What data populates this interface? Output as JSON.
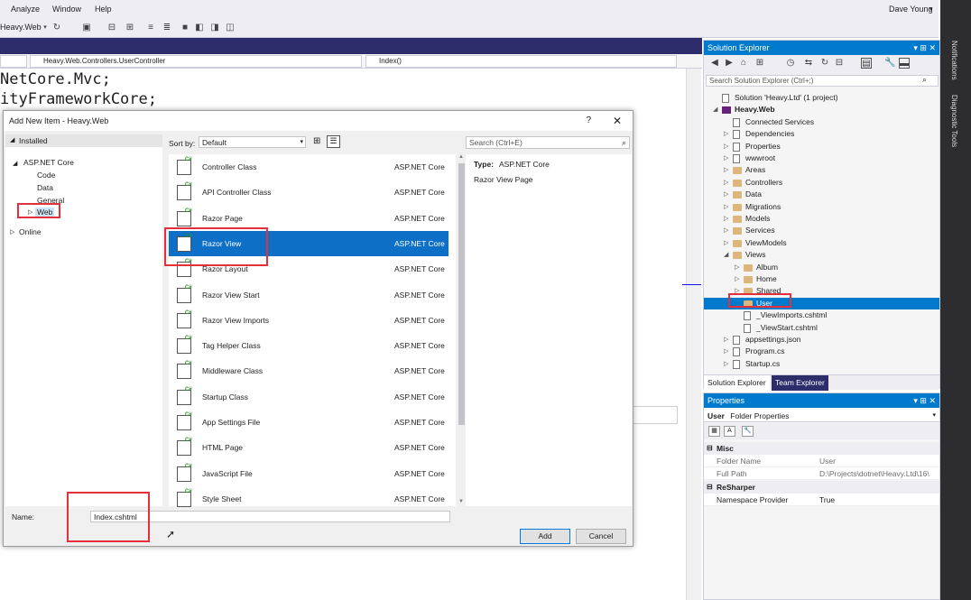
{
  "menu": {
    "items": [
      "Analyze",
      "Window",
      "Help"
    ]
  },
  "account": {
    "user_name": "Dave Young"
  },
  "toolbar": {
    "project_name": "Heavy.Web"
  },
  "editor": {
    "class_dropdown": "Heavy.Web.Controllers.UserController",
    "member_dropdown": "Index()",
    "code_lines": [
      "NetCore.Mvc;",
      "ityFrameworkCore;"
    ]
  },
  "dialog": {
    "title": "Add New Item - Heavy.Web",
    "help": "?",
    "close": "✕",
    "sort_label": "Sort by:",
    "sort_value": "Default",
    "search_placeholder": "Search (Ctrl+E)",
    "tree": {
      "installed": "Installed",
      "aspnet_core": "ASP.NET Core",
      "code": "Code",
      "data": "Data",
      "general": "General",
      "web": "Web",
      "online": "Online"
    },
    "items": [
      {
        "name": "Controller Class",
        "category": "ASP.NET Core"
      },
      {
        "name": "API Controller Class",
        "category": "ASP.NET Core"
      },
      {
        "name": "Razor Page",
        "category": "ASP.NET Core"
      },
      {
        "name": "Razor View",
        "category": "ASP.NET Core"
      },
      {
        "name": "Razor Layout",
        "category": "ASP.NET Core"
      },
      {
        "name": "Razor View Start",
        "category": "ASP.NET Core"
      },
      {
        "name": "Razor View Imports",
        "category": "ASP.NET Core"
      },
      {
        "name": "Tag Helper Class",
        "category": "ASP.NET Core"
      },
      {
        "name": "Middleware Class",
        "category": "ASP.NET Core"
      },
      {
        "name": "Startup Class",
        "category": "ASP.NET Core"
      },
      {
        "name": "App Settings File",
        "category": "ASP.NET Core"
      },
      {
        "name": "HTML Page",
        "category": "ASP.NET Core"
      },
      {
        "name": "JavaScript File",
        "category": "ASP.NET Core"
      },
      {
        "name": "Style Sheet",
        "category": "ASP.NET Core"
      }
    ],
    "details": {
      "type_label": "Type:",
      "type_value": "ASP.NET Core",
      "description": "Razor View Page"
    },
    "name_label": "Name:",
    "name_value": "Index.cshtml",
    "add_button": "Add",
    "cancel_button": "Cancel"
  },
  "solution_explorer": {
    "title": "Solution Explorer",
    "title_tools": "▾ ⊞ ✕",
    "search_placeholder": "Search Solution Explorer (Ctrl+;)",
    "tree": [
      {
        "label": "Solution 'Heavy.Ltd' (1 project)",
        "icon": "solution-icon"
      },
      {
        "label": "Heavy.Web",
        "icon": "project-icon"
      },
      {
        "label": "Connected Services",
        "icon": "connected-services-icon"
      },
      {
        "label": "Dependencies",
        "icon": "dependencies-icon"
      },
      {
        "label": "Properties",
        "icon": "wrench-icon"
      },
      {
        "label": "wwwroot",
        "icon": "globe-icon"
      },
      {
        "label": "Areas",
        "icon": "folder-icon"
      },
      {
        "label": "Controllers",
        "icon": "folder-icon"
      },
      {
        "label": "Data",
        "icon": "folder-icon"
      },
      {
        "label": "Migrations",
        "icon": "folder-icon"
      },
      {
        "label": "Models",
        "icon": "folder-icon"
      },
      {
        "label": "Services",
        "icon": "folder-icon"
      },
      {
        "label": "ViewModels",
        "icon": "folder-icon"
      },
      {
        "label": "Views",
        "icon": "folder-open-icon"
      },
      {
        "label": "Album",
        "icon": "folder-icon"
      },
      {
        "label": "Home",
        "icon": "folder-icon"
      },
      {
        "label": "Shared",
        "icon": "folder-icon"
      },
      {
        "label": "User",
        "icon": "folder-icon"
      },
      {
        "label": "_ViewImports.cshtml",
        "icon": "cshtml-file-icon"
      },
      {
        "label": "_ViewStart.cshtml",
        "icon": "cshtml-file-icon"
      },
      {
        "label": "appsettings.json",
        "icon": "json-file-icon"
      },
      {
        "label": "Program.cs",
        "icon": "csharp-file-icon"
      },
      {
        "label": "Startup.cs",
        "icon": "csharp-file-icon"
      }
    ],
    "tabs": [
      "Solution Explorer",
      "Team Explorer"
    ]
  },
  "properties": {
    "title": "Properties",
    "title_tools": "▾ ⊞ ✕",
    "object_name": "User",
    "object_type": "Folder Properties",
    "categories": [
      {
        "name": "Misc",
        "rows": [
          {
            "name": "Folder Name",
            "value": "User"
          },
          {
            "name": "Full Path",
            "value": "D:\\Projects\\dotnet\\Heavy.Ltd\\16\\"
          }
        ]
      },
      {
        "name": "ReSharper",
        "rows": [
          {
            "name": "Namespace Provider",
            "value": "True"
          }
        ]
      }
    ]
  },
  "side_strip": {
    "notifications": "Notifications",
    "diagnostic_tools": "Diagnostic Tools"
  },
  "colors": {
    "accent": "#007acc",
    "selection": "#0e6fc7",
    "highlight_box": "#e3303b",
    "band": "#2d2d6b"
  }
}
